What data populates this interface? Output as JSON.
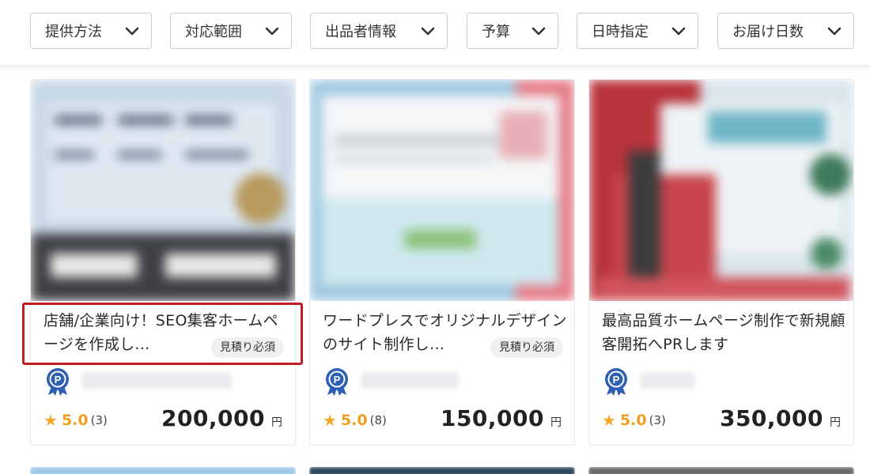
{
  "filters": [
    {
      "label": "提供方法"
    },
    {
      "label": "対応範囲"
    },
    {
      "label": "出品者情報"
    },
    {
      "label": "予算"
    },
    {
      "label": "日時指定"
    },
    {
      "label": "お届け日数"
    }
  ],
  "cards": [
    {
      "title": "店舗/企業向け！SEO集客ホームページを作成し...",
      "badge": "見積り必須",
      "seller_badge_icon": "p-rank-ribbon-icon",
      "rating": "5.0",
      "review_count": "(3)",
      "price": "200,000",
      "currency": "円"
    },
    {
      "title": "ワードプレスでオリジナルデザインのサイト制作し...",
      "badge": "見積り必須",
      "seller_badge_icon": "p-rank-ribbon-icon",
      "rating": "5.0",
      "review_count": "(8)",
      "price": "150,000",
      "currency": "円"
    },
    {
      "title": "最高品質ホームページ制作で新規顧客開拓へPRします",
      "badge": "",
      "seller_badge_icon": "p-rank-ribbon-icon",
      "rating": "5.0",
      "review_count": "(3)",
      "price": "350,000",
      "currency": "円"
    }
  ],
  "colors": {
    "star": "#f5a623",
    "rank_badge": "#2f5fb3",
    "highlight": "#c01d24"
  }
}
